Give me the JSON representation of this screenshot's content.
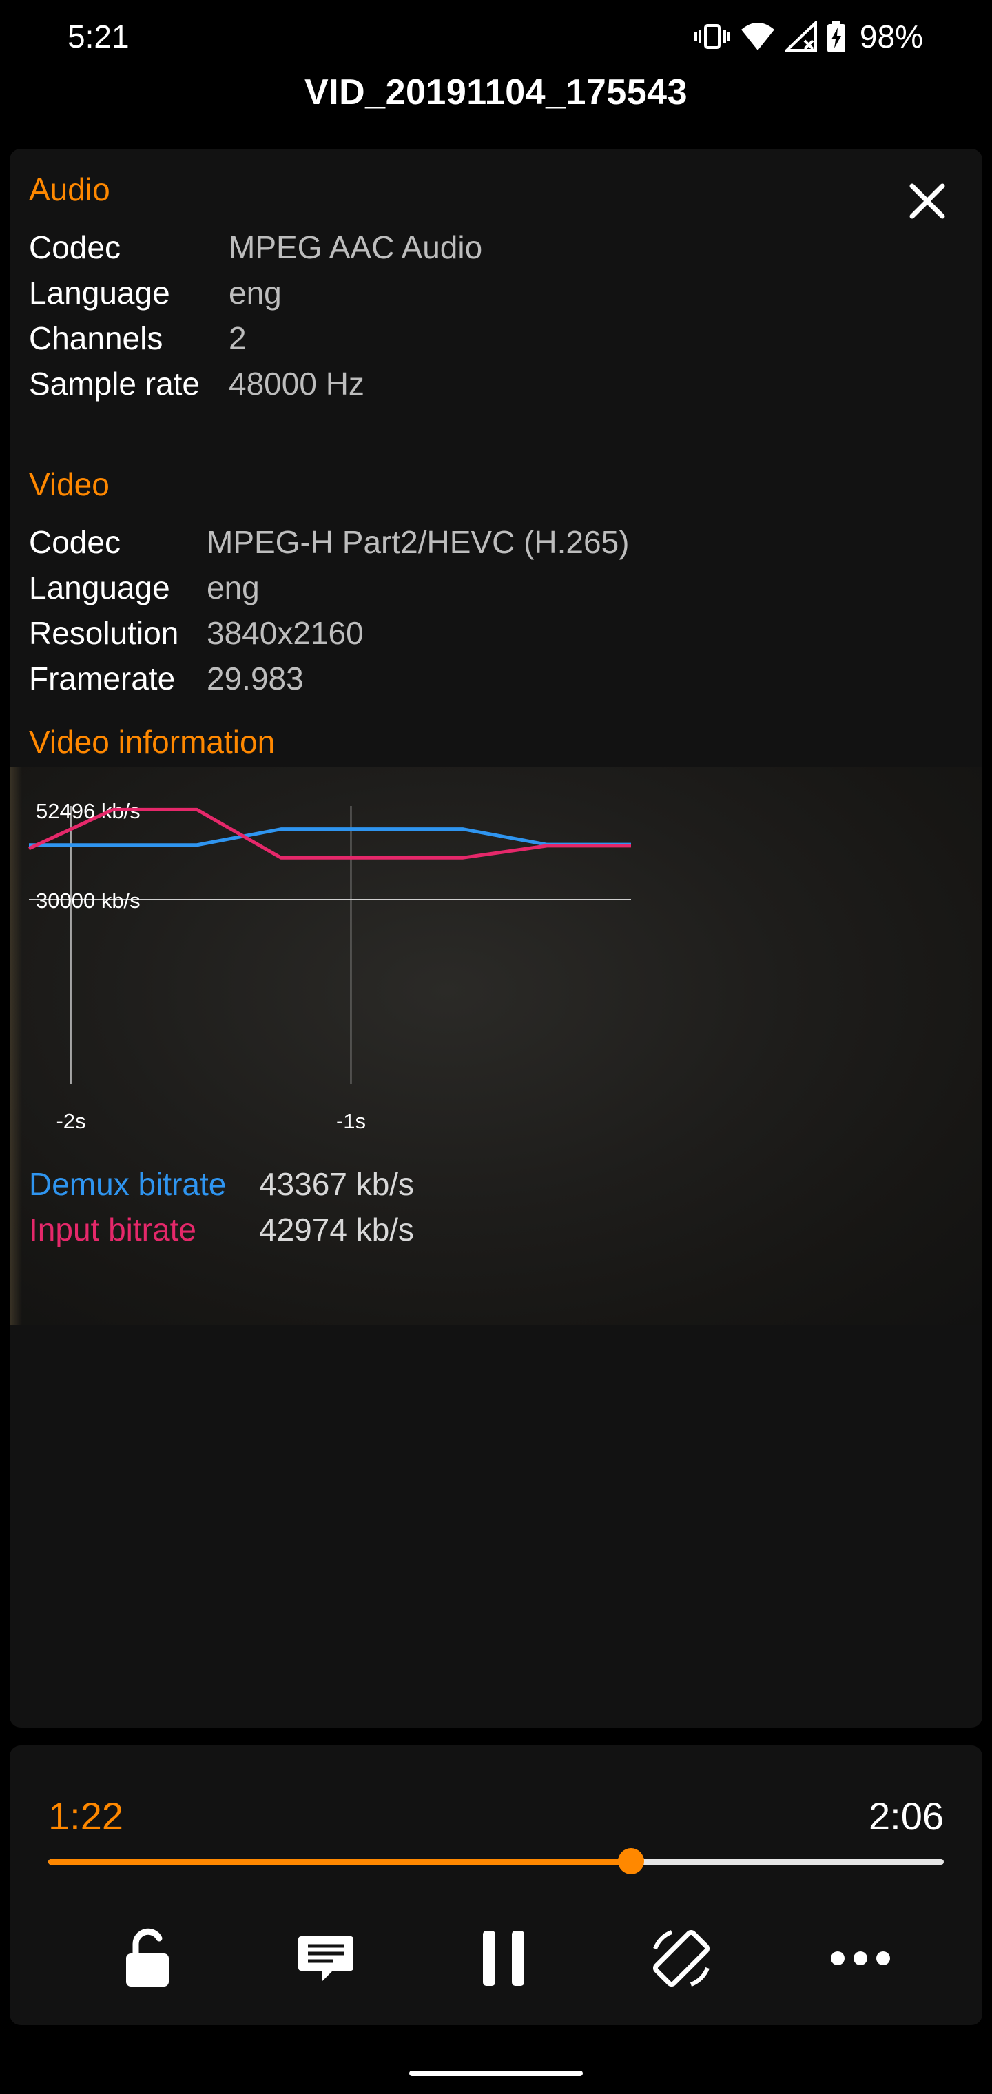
{
  "status_bar": {
    "time": "5:21",
    "battery": "98%",
    "icons": [
      "vibrate-icon",
      "wifi-icon",
      "signal-icon",
      "battery-charging-icon"
    ]
  },
  "title": "VID_20191104_175543",
  "audio": {
    "heading": "Audio",
    "rows": [
      {
        "label": "Codec",
        "value": "MPEG AAC Audio"
      },
      {
        "label": "Language",
        "value": "eng"
      },
      {
        "label": "Channels",
        "value": "2"
      },
      {
        "label": "Sample rate",
        "value": "48000 Hz"
      }
    ]
  },
  "video": {
    "heading": "Video",
    "rows": [
      {
        "label": "Codec",
        "value": "MPEG-H Part2/HEVC (H.265)"
      },
      {
        "label": "Language",
        "value": "eng"
      },
      {
        "label": "Resolution",
        "value": "3840x2160"
      },
      {
        "label": "Framerate",
        "value": "29.983"
      }
    ]
  },
  "video_information": {
    "heading": "Video information",
    "legend": [
      {
        "label": "Demux bitrate",
        "value": "43367 kb/s",
        "color": "#2f95f0"
      },
      {
        "label": "Input bitrate",
        "value": "42974 kb/s",
        "color": "#e5286a"
      }
    ]
  },
  "chart_data": {
    "type": "line",
    "x_tick_labels": [
      "-2s",
      "-1s"
    ],
    "y_tick_labels": [
      "52496 kb/s",
      "30000 kb/s"
    ],
    "x_range_s": [
      -2.15,
      0.0
    ],
    "y_range_kbps": [
      -16500,
      52496
    ],
    "series": [
      {
        "name": "Demux bitrate",
        "color": "#2f95f0",
        "x": [
          -2.15,
          -1.55,
          -1.25,
          -0.6,
          -0.3,
          0.0
        ],
        "y": [
          43700,
          43700,
          47700,
          47700,
          43800,
          43800
        ]
      },
      {
        "name": "Input bitrate",
        "color": "#e5286a",
        "x": [
          -2.15,
          -1.85,
          -1.55,
          -1.25,
          -0.6,
          -0.3,
          0.0
        ],
        "y": [
          42800,
          52600,
          52600,
          40500,
          40500,
          43500,
          43500
        ]
      }
    ]
  },
  "playback": {
    "current": "1:22",
    "duration": "2:06",
    "progress": 0.6508,
    "accent": "#ff8800",
    "buttons": [
      "lock-icon",
      "subtitles-icon",
      "pause-icon",
      "rotate-icon",
      "more-icon"
    ]
  }
}
